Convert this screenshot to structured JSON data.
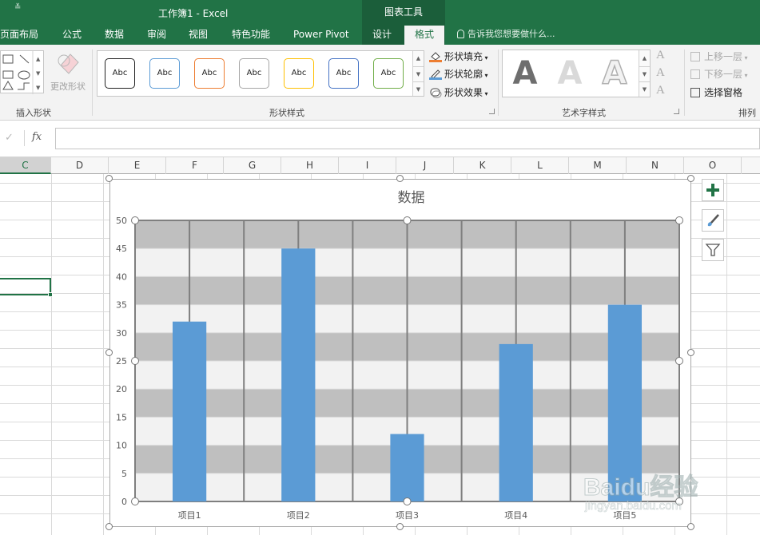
{
  "window": {
    "title": "工作簿1 - Excel",
    "context_tool": "图表工具",
    "quick_access": "≚"
  },
  "tabs": [
    {
      "label": "页面布局"
    },
    {
      "label": "公式"
    },
    {
      "label": "数据"
    },
    {
      "label": "审阅"
    },
    {
      "label": "视图"
    },
    {
      "label": "特色功能"
    },
    {
      "label": "Power Pivot"
    },
    {
      "label": "设计"
    },
    {
      "label": "格式",
      "active": true
    }
  ],
  "tell_me": "告诉我您想要做什么...",
  "ribbon": {
    "insert_shapes": {
      "label": "插入形状",
      "edit_shape": "更改形状"
    },
    "shape_styles": {
      "label": "形状样式",
      "gallery": [
        {
          "text": "Abc",
          "color": "#222222"
        },
        {
          "text": "Abc",
          "color": "#5b9bd5"
        },
        {
          "text": "Abc",
          "color": "#ed7d31"
        },
        {
          "text": "Abc",
          "color": "#a5a5a5"
        },
        {
          "text": "Abc",
          "color": "#ffc000"
        },
        {
          "text": "Abc",
          "color": "#4472c4"
        },
        {
          "text": "Abc",
          "color": "#70ad47"
        }
      ],
      "fill": "形状填充",
      "outline": "形状轮廓",
      "effects": "形状效果"
    },
    "wordart": {
      "label": "艺术字样式",
      "letter": "A"
    },
    "arrange": {
      "label": "排列",
      "bring_forward": "上移一层",
      "send_backward": "下移一层",
      "selection_pane": "选择窗格"
    }
  },
  "formula_bar": {
    "fx": "fx",
    "confirm": "✓",
    "value": ""
  },
  "columns": [
    "C",
    "D",
    "E",
    "F",
    "G",
    "H",
    "I",
    "J",
    "K",
    "L",
    "M",
    "N",
    "O"
  ],
  "chart_data": {
    "type": "bar",
    "title": "数据",
    "categories": [
      "项目1",
      "项目2",
      "项目3",
      "项目4",
      "项目5"
    ],
    "values": [
      32,
      45,
      12,
      28,
      35
    ],
    "ylim": [
      0,
      50
    ],
    "yticks": [
      "0",
      "5",
      "10",
      "15",
      "20",
      "25",
      "30",
      "35",
      "40",
      "45",
      "50"
    ],
    "grid": true,
    "bar_color": "#5b9bd5"
  },
  "watermark": {
    "brand": "Baidu经验",
    "url": "jingyan.baidu.com"
  },
  "colors": {
    "excel_green": "#217346",
    "band_dark": "#bfbfbf",
    "band_light": "#f2f2f2"
  }
}
